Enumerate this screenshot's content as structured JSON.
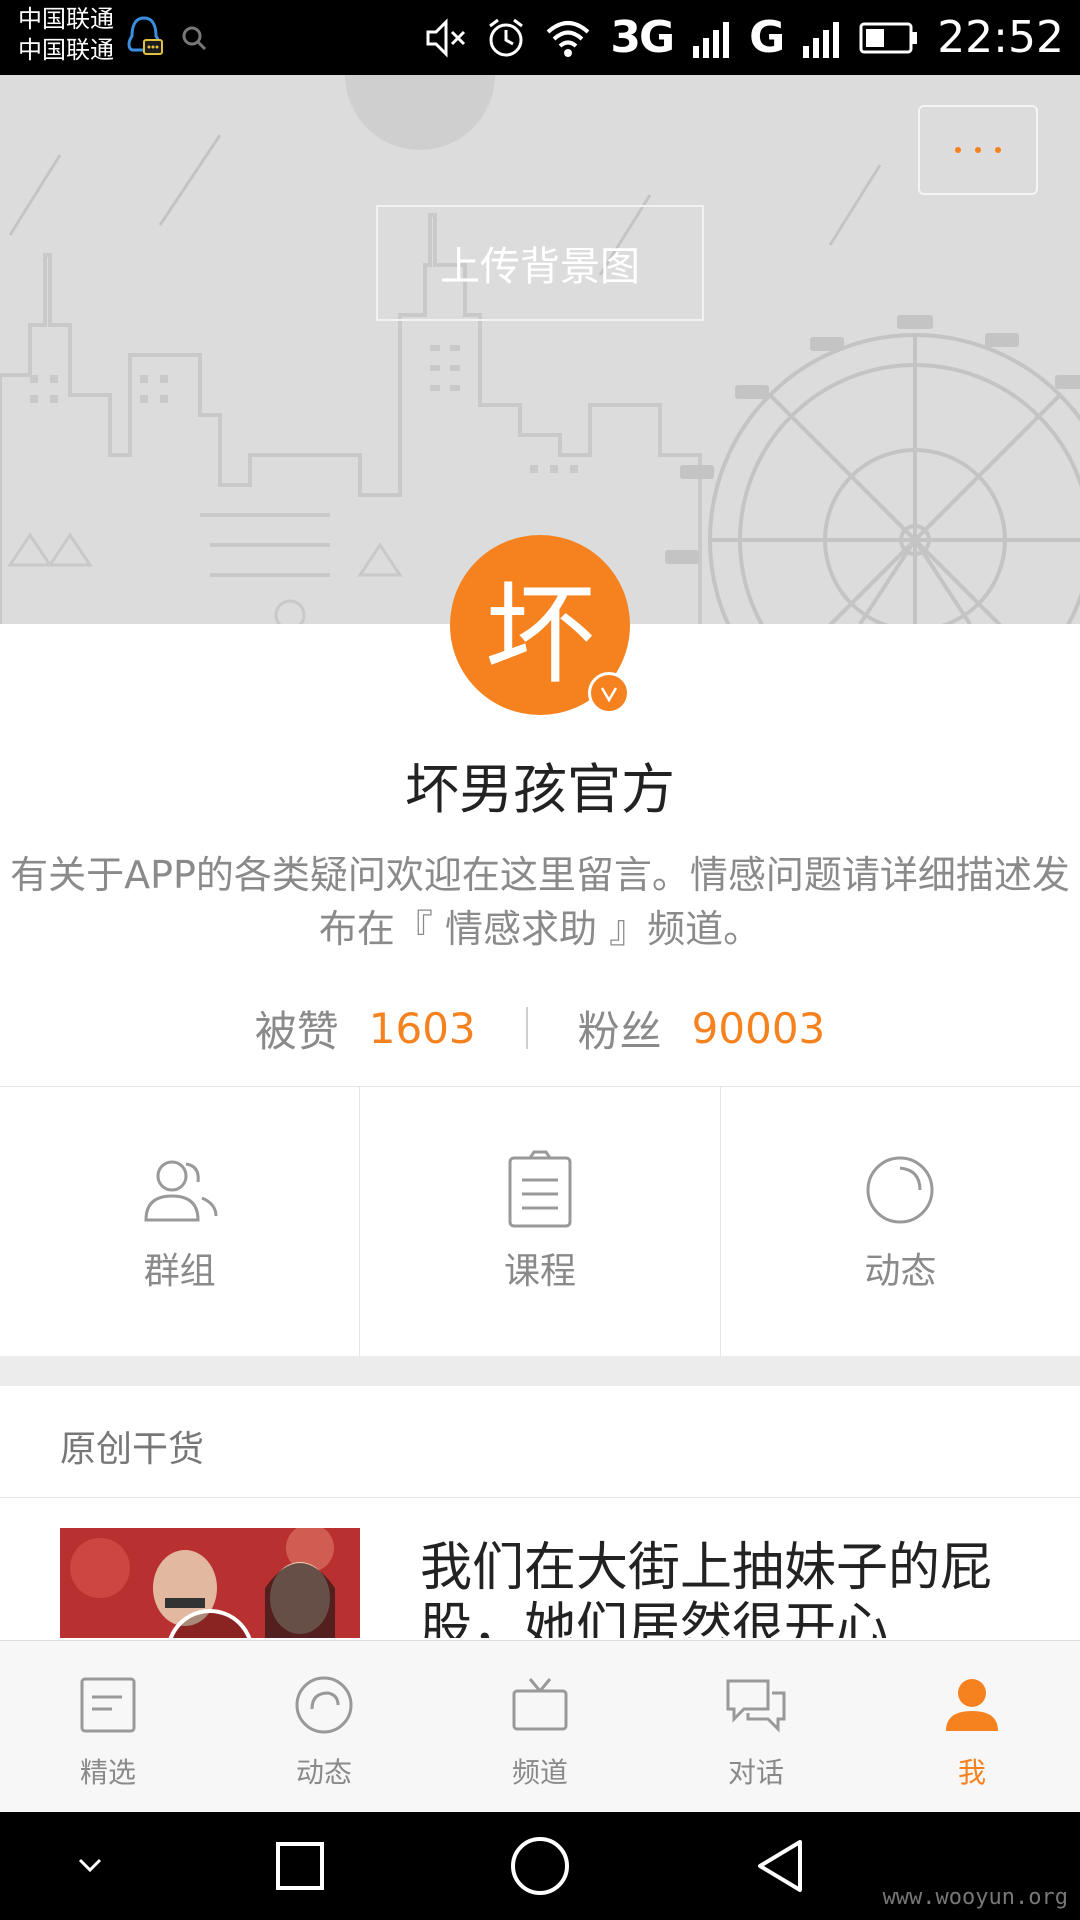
{
  "status_bar": {
    "carrier_1": "中国联通",
    "carrier_2": "中国联通",
    "network_1": "3G",
    "network_2": "G",
    "time": "22:52"
  },
  "header": {
    "upload_label": "上传背景图",
    "more_icon": "more-dots-icon"
  },
  "profile": {
    "avatar_char": "坏",
    "name": "坏男孩官方",
    "bio": "有关于APP的各类疑问欢迎在这里留言。情感问题请详细描述发布在『 情感求助 』频道。",
    "likes_label": "被赞",
    "likes_value": "1603",
    "fans_label": "粉丝",
    "fans_value": "90003"
  },
  "features": [
    {
      "label": "群组",
      "icon": "group-icon"
    },
    {
      "label": "课程",
      "icon": "course-icon"
    },
    {
      "label": "动态",
      "icon": "moments-icon"
    }
  ],
  "section": {
    "title": "原创干货"
  },
  "article": {
    "title": "我们在大街上抽妹子的屁股，她们居然很开心"
  },
  "tabbar": [
    {
      "label": "精选",
      "icon": "featured-icon",
      "active": false
    },
    {
      "label": "动态",
      "icon": "moments-icon",
      "active": false
    },
    {
      "label": "频道",
      "icon": "tv-icon",
      "active": false
    },
    {
      "label": "对话",
      "icon": "chat-icon",
      "active": false
    },
    {
      "label": "我",
      "icon": "person-icon",
      "active": true
    }
  ],
  "watermark": "www.wooyun.org",
  "colors": {
    "accent": "#f5821f",
    "banner_bg": "#dcdcdc",
    "text_secondary": "#8a8a8a"
  }
}
